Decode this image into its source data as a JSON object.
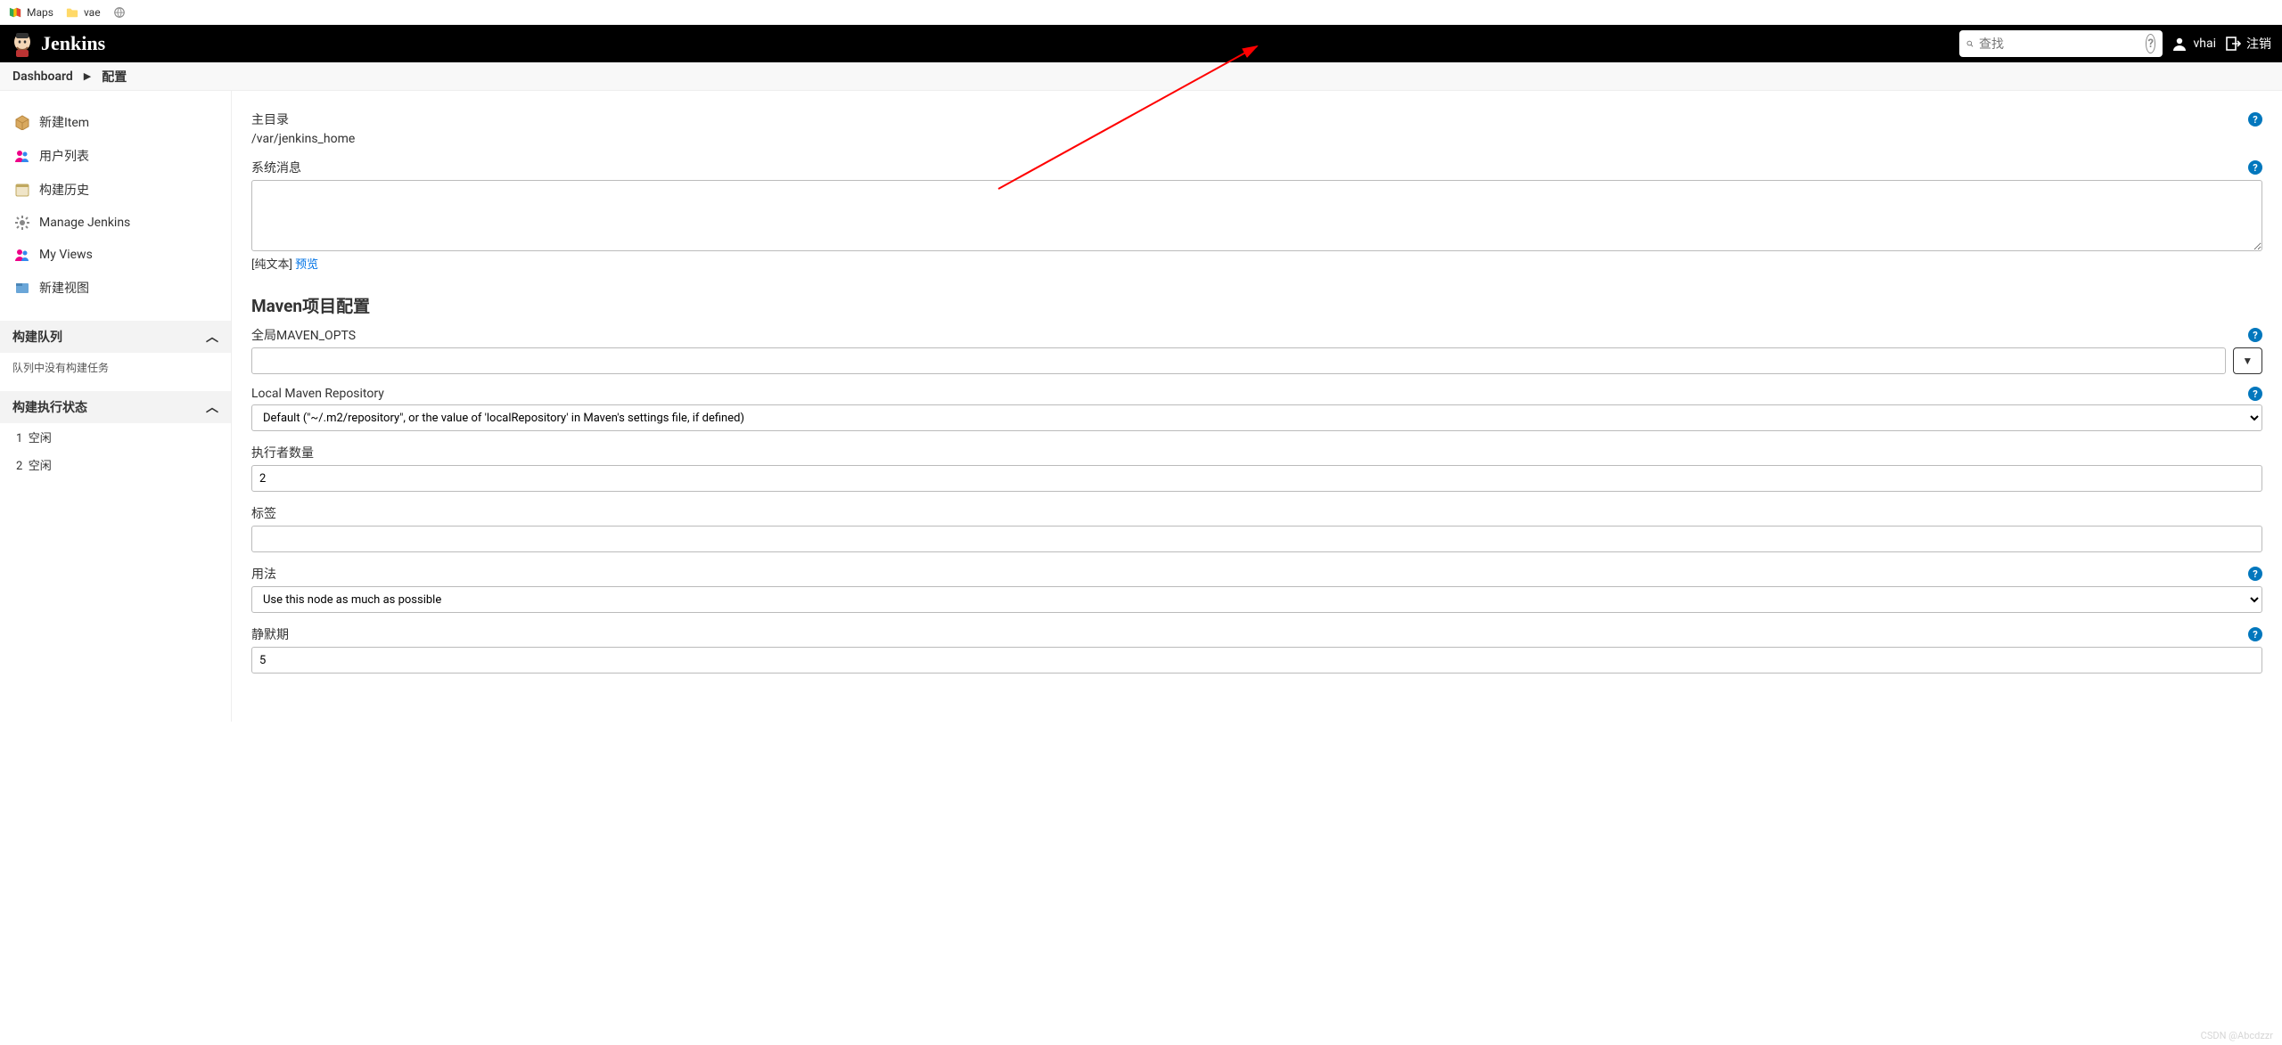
{
  "browser": {
    "bookmarks": [
      {
        "label": "Maps",
        "icon": "maps-icon"
      },
      {
        "label": "vae",
        "icon": "folder-icon"
      },
      {
        "label": "",
        "icon": "globe-icon"
      }
    ]
  },
  "header": {
    "brand": "Jenkins",
    "search_placeholder": "查找",
    "user": "vhai",
    "logout": "注销"
  },
  "breadcrumbs": {
    "items": [
      "Dashboard",
      "配置"
    ]
  },
  "sidebar": {
    "links": [
      {
        "label": "新建Item",
        "name": "sidebar-item-new"
      },
      {
        "label": "用户列表",
        "name": "sidebar-item-people"
      },
      {
        "label": "构建历史",
        "name": "sidebar-item-build-history"
      },
      {
        "label": "Manage Jenkins",
        "name": "sidebar-item-manage"
      },
      {
        "label": "My Views",
        "name": "sidebar-item-my-views"
      },
      {
        "label": "新建视图",
        "name": "sidebar-item-new-view"
      }
    ],
    "queue_header": "构建队列",
    "queue_empty": "队列中没有构建任务",
    "exec_header": "构建执行状态",
    "executors": [
      {
        "id": "1",
        "status": "空闲"
      },
      {
        "id": "2",
        "status": "空闲"
      }
    ]
  },
  "form": {
    "home_dir_label": "主目录",
    "home_dir_value": "/var/jenkins_home",
    "sys_msg_label": "系统消息",
    "sys_msg_value": "",
    "plain_text_label": "[纯文本]",
    "preview_label": "预览",
    "maven_section": "Maven项目配置",
    "maven_opts_label": "全局MAVEN_OPTS",
    "maven_opts_value": "",
    "local_repo_label": "Local Maven Repository",
    "local_repo_value": "Default (\"~/.m2/repository\", or the value of 'localRepository' in Maven's settings file, if defined)",
    "executors_label": "执行者数量",
    "executors_value": "2",
    "labels_label": "标签",
    "labels_value": "",
    "usage_label": "用法",
    "usage_value": "Use this node as much as possible",
    "quiet_label": "静默期",
    "quiet_value": "5"
  },
  "watermark": "CSDN @Abcdzzr"
}
